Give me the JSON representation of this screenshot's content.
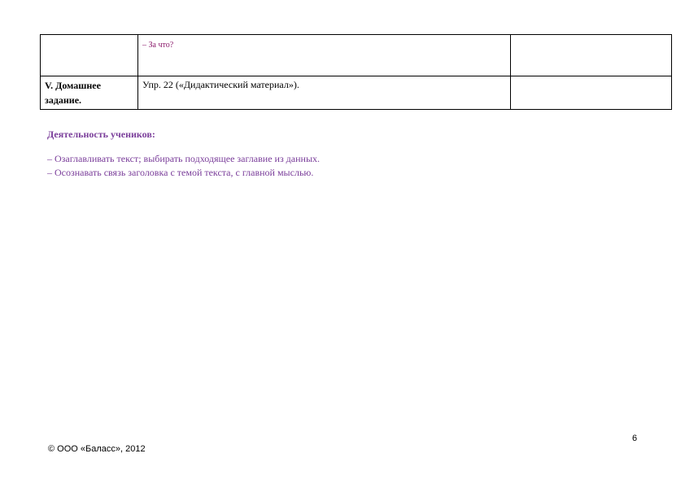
{
  "table": {
    "rows": [
      {
        "stage": "",
        "content": "– За что?",
        "notes": ""
      },
      {
        "stage": "V. Домашнее задание.",
        "content": "Упр. 22 («Дидактический материал»).",
        "notes": ""
      }
    ]
  },
  "activity": {
    "heading": "Деятельность учеников:",
    "items": [
      "– Озаглавливать текст; выбирать подходящее заглавие из данных.",
      "– Осознавать связь заголовка с темой текста, с главной мыслью."
    ]
  },
  "footer": {
    "page_number": "6",
    "copyright": "© ООО «Баласс», 2012"
  },
  "colors": {
    "accent_purple": "#7a3d9a",
    "magenta": "#8b1a6b"
  }
}
